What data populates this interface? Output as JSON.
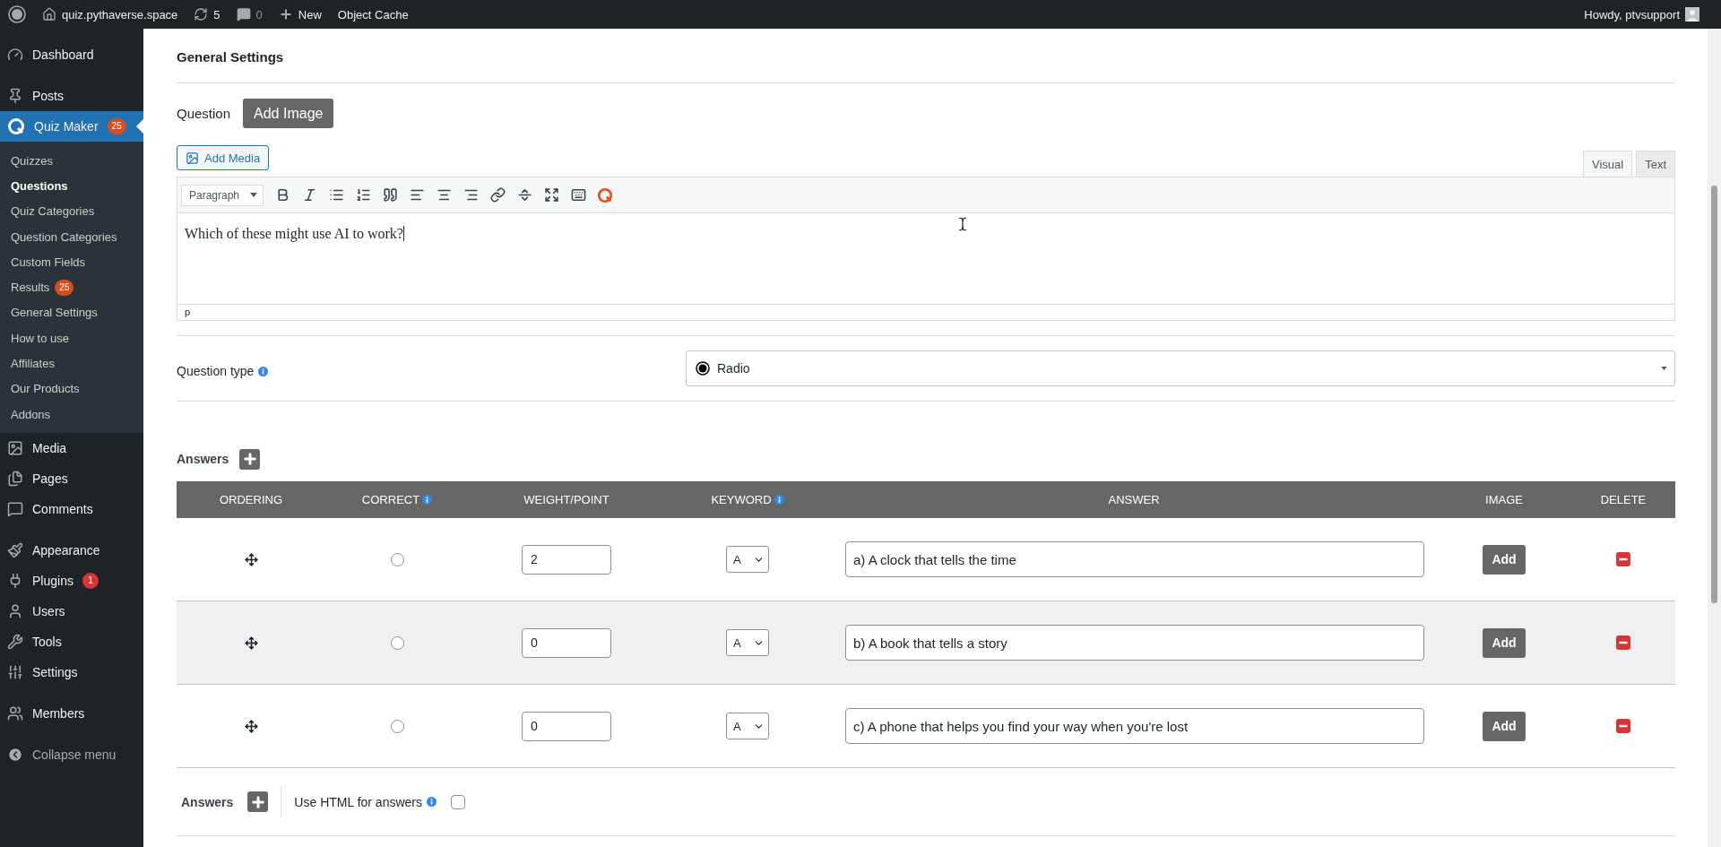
{
  "admin_bar": {
    "site": "quiz.pythaverse.space",
    "updates": "5",
    "comments": "0",
    "new": "New",
    "object_cache": "Object Cache",
    "greeting": "Howdy, ptvsupport"
  },
  "sidebar": {
    "groups": [
      [
        {
          "label": "Dashboard",
          "selected": false
        }
      ],
      [
        {
          "label": "Posts",
          "selected": false
        },
        {
          "label": "Quiz Maker",
          "selected": true,
          "badge": "25",
          "children": [
            {
              "label": "Quizzes",
              "selected": false
            },
            {
              "label": "Questions",
              "selected": true
            },
            {
              "label": "Quiz Categories",
              "selected": false
            },
            {
              "label": "Question Categories",
              "selected": false
            },
            {
              "label": "Custom Fields",
              "selected": false
            },
            {
              "label": "Results",
              "selected": false,
              "badge": "25"
            },
            {
              "label": "General Settings",
              "selected": false
            },
            {
              "label": "How to use",
              "selected": false
            },
            {
              "label": "Affiliates",
              "selected": false
            },
            {
              "label": "Our Products",
              "selected": false
            },
            {
              "label": "Addons",
              "selected": false
            }
          ]
        },
        {
          "label": "Media",
          "selected": false
        },
        {
          "label": "Pages",
          "selected": false
        },
        {
          "label": "Comments",
          "selected": false
        }
      ],
      [
        {
          "label": "Appearance",
          "selected": false
        },
        {
          "label": "Plugins",
          "selected": false,
          "badge": "1"
        },
        {
          "label": "Users",
          "selected": false
        },
        {
          "label": "Tools",
          "selected": false
        },
        {
          "label": "Settings",
          "selected": false
        }
      ],
      [
        {
          "label": "Members",
          "selected": false
        }
      ]
    ],
    "collapse": "Collapse menu"
  },
  "page": {
    "title": "General Settings"
  },
  "question": {
    "label": "Question",
    "add_image": "Add Image",
    "add_media": "Add Media",
    "tabs": [
      {
        "label": "Visual",
        "selected": true
      },
      {
        "label": "Text",
        "selected": false
      }
    ],
    "format": "Paragraph",
    "content": "Which of these might use AI to work?",
    "path": "p"
  },
  "question_type": {
    "label": "Question type",
    "value": "Radio"
  },
  "answers": {
    "label": "Answers",
    "columns": [
      {
        "label": "ORDERING",
        "info": false
      },
      {
        "label": "CORRECT",
        "info": true
      },
      {
        "label": "WEIGHT/POINT",
        "info": false
      },
      {
        "label": "KEYWORD",
        "info": true
      },
      {
        "label": "ANSWER",
        "info": false
      },
      {
        "label": "IMAGE",
        "info": false
      },
      {
        "label": "DELETE",
        "info": false
      }
    ],
    "rows": [
      {
        "correct": false,
        "weight": "2",
        "keyword": "A",
        "answer": "a) A clock that tells the time",
        "image_button": "Add",
        "highlighted": false
      },
      {
        "correct": false,
        "weight": "0",
        "keyword": "A",
        "answer": "b) A book that tells a story",
        "image_button": "Add",
        "highlighted": true
      },
      {
        "correct": false,
        "weight": "0",
        "keyword": "A",
        "answer": "c) A phone that helps you find your way when you're lost",
        "image_button": "Add",
        "highlighted": false
      }
    ]
  },
  "footer": {
    "label": "Answers",
    "html_option": "Use HTML for answers",
    "html_checked": false
  }
}
